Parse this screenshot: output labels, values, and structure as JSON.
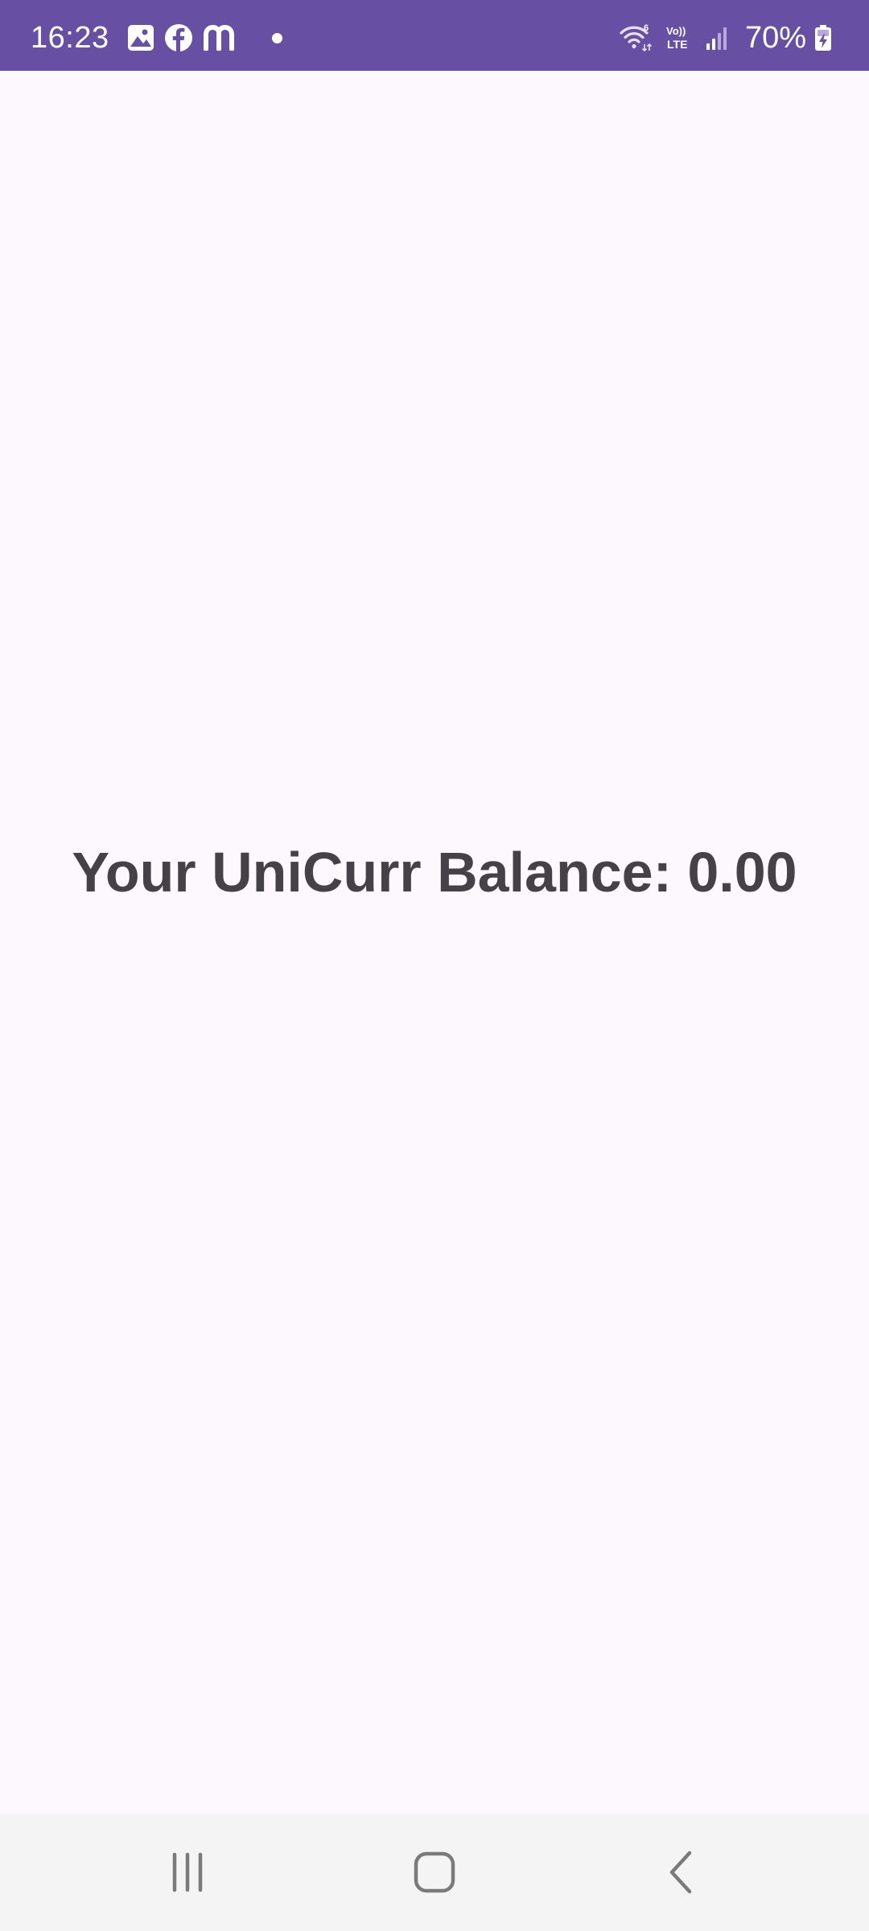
{
  "status_bar": {
    "time": "16:23",
    "battery_percent": "70%",
    "background_color": "#6750A4",
    "notification_icons": [
      "gallery-icon",
      "facebook-icon",
      "messenger-m-icon",
      "notification-dot"
    ],
    "system_icons": [
      "wifi-6-icon",
      "volte-icon",
      "cell-signal-icon",
      "battery-charging-icon"
    ],
    "volte_label_top": "Vo))",
    "volte_label_bottom": "LTE",
    "wifi_label": "6"
  },
  "main": {
    "balance_text": "Your UniCurr Balance: 0.00",
    "background_color": "#FDF7FE",
    "text_color": "#444148"
  },
  "nav_bar": {
    "buttons": [
      "recents-icon",
      "home-icon",
      "back-icon"
    ],
    "background_color": "#F4F4F4"
  }
}
